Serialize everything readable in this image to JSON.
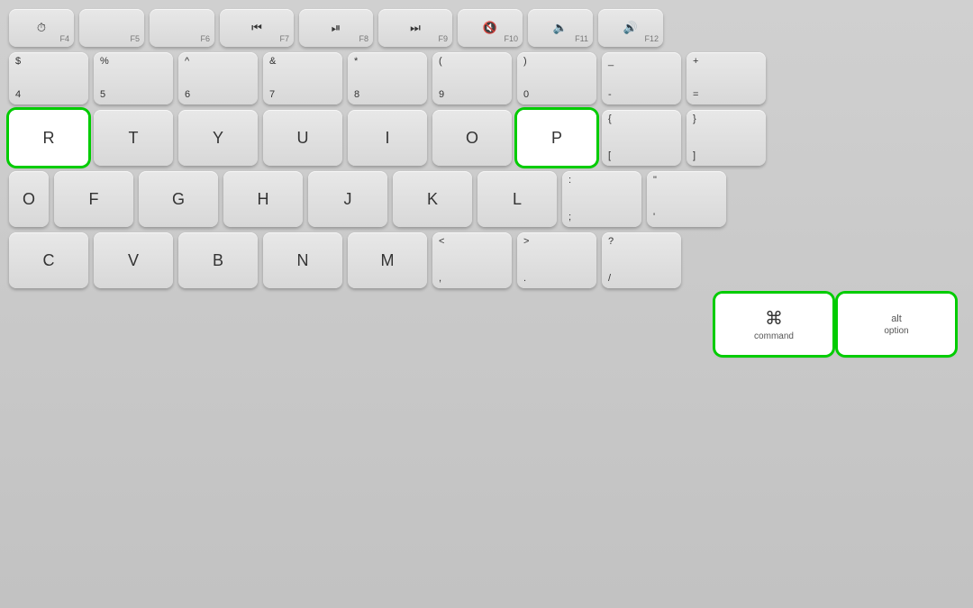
{
  "keyboard": {
    "background_color": "#c8c8c8",
    "highlight_color": "#00cc00",
    "rows": {
      "fn_row": {
        "keys": [
          {
            "id": "F4",
            "icon": "⏱",
            "label": "F4"
          },
          {
            "id": "F5",
            "icon": "",
            "label": "F5"
          },
          {
            "id": "F6",
            "icon": "",
            "label": "F6"
          },
          {
            "id": "F7",
            "icon": "◀◀",
            "label": "F7"
          },
          {
            "id": "F8",
            "icon": "▶⏸",
            "label": "F8"
          },
          {
            "id": "F9",
            "icon": "▶▶",
            "label": "F9"
          },
          {
            "id": "F10",
            "icon": "🔇",
            "label": "F10"
          },
          {
            "id": "F11",
            "icon": "🔈",
            "label": "F11"
          },
          {
            "id": "F12",
            "icon": "🔊",
            "label": "F12"
          }
        ]
      },
      "num_row": {
        "keys": [
          {
            "id": "4",
            "top": "$",
            "bottom": "4"
          },
          {
            "id": "5",
            "top": "%",
            "bottom": "5"
          },
          {
            "id": "6",
            "top": "^",
            "bottom": "6"
          },
          {
            "id": "7",
            "top": "&",
            "bottom": "7"
          },
          {
            "id": "8",
            "top": "*",
            "bottom": "8"
          },
          {
            "id": "9",
            "top": "(",
            "bottom": "9"
          },
          {
            "id": "0",
            "top": ")",
            "bottom": "0"
          },
          {
            "id": "minus",
            "top": "_",
            "bottom": "-"
          },
          {
            "id": "equals",
            "top": "+",
            "bottom": "="
          }
        ]
      },
      "qwerty_row": {
        "keys": [
          {
            "id": "R",
            "label": "R",
            "highlighted": true
          },
          {
            "id": "T",
            "label": "T"
          },
          {
            "id": "Y",
            "label": "Y"
          },
          {
            "id": "U",
            "label": "U"
          },
          {
            "id": "I",
            "label": "I"
          },
          {
            "id": "O",
            "label": "O"
          },
          {
            "id": "P",
            "label": "P",
            "highlighted": true
          },
          {
            "id": "lbracket",
            "top": "{",
            "bottom": "["
          },
          {
            "id": "rbracket",
            "top": "}",
            "bottom": "]"
          }
        ]
      },
      "asdf_row": {
        "keys": [
          {
            "id": "F",
            "label": "F"
          },
          {
            "id": "G",
            "label": "G"
          },
          {
            "id": "H",
            "label": "H"
          },
          {
            "id": "J",
            "label": "J"
          },
          {
            "id": "K",
            "label": "K"
          },
          {
            "id": "L",
            "label": "L"
          },
          {
            "id": "semicolon",
            "top": ":",
            "bottom": ";"
          },
          {
            "id": "quote",
            "top": "\"",
            "bottom": "'"
          }
        ]
      },
      "zxcv_row": {
        "keys": [
          {
            "id": "C",
            "label": "C"
          },
          {
            "id": "V",
            "label": "V"
          },
          {
            "id": "B",
            "label": "B"
          },
          {
            "id": "N",
            "label": "N"
          },
          {
            "id": "M",
            "label": "M"
          },
          {
            "id": "comma",
            "top": "<",
            "bottom": ","
          },
          {
            "id": "period",
            "top": ">",
            "bottom": "."
          },
          {
            "id": "slash",
            "top": "?",
            "bottom": "/"
          }
        ]
      },
      "bottom_row": {
        "keys": [
          {
            "id": "command",
            "symbol": "⌘",
            "label": "command",
            "highlighted": true
          },
          {
            "id": "option",
            "symbol": "alt",
            "label": "option",
            "highlighted": true
          }
        ]
      }
    }
  }
}
